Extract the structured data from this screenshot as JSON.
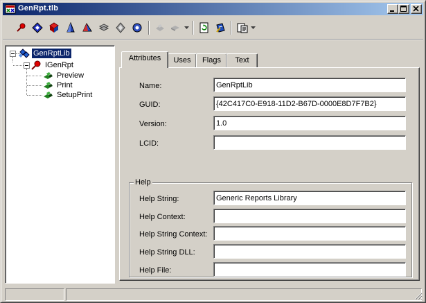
{
  "window": {
    "title": "GenRpt.tlb"
  },
  "toolbar": {
    "buttons": [
      {
        "name": "module-icon"
      },
      {
        "name": "dispinterface-icon"
      },
      {
        "name": "interface-icon"
      },
      {
        "name": "coclass-icon"
      },
      {
        "name": "enum-icon"
      },
      {
        "name": "record-icon"
      },
      {
        "name": "union-icon"
      },
      {
        "name": "alias-icon"
      },
      {
        "name": "method-icon"
      },
      {
        "name": "property-icon"
      },
      {
        "name": "refresh-icon"
      },
      {
        "name": "register-icon"
      },
      {
        "name": "export-icon"
      }
    ]
  },
  "tree": {
    "root": {
      "label": "GenRptLib"
    },
    "interface": {
      "label": "IGenRpt"
    },
    "methods": [
      "Preview",
      "Print",
      "SetupPrint"
    ]
  },
  "tabs": [
    "Attributes",
    "Uses",
    "Flags",
    "Text"
  ],
  "attributes": {
    "name_label": "Name:",
    "name_value": "GenRptLib",
    "guid_label": "GUID:",
    "guid_value": "{42C417C0-E918-11D2-B67D-0000E8D7F7B2}",
    "version_label": "Version:",
    "version_value": "1.0",
    "lcid_label": "LCID:",
    "lcid_value": ""
  },
  "help": {
    "group_label": "Help",
    "string_label": "Help String:",
    "string_value": "Generic Reports Library",
    "context_label": "Help Context:",
    "context_value": "",
    "string_context_label": "Help String Context:",
    "string_context_value": "",
    "string_dll_label": "Help String DLL:",
    "string_dll_value": "",
    "file_label": "Help File:",
    "file_value": ""
  },
  "colors": {
    "titlebar_start": "#0a246a",
    "titlebar_end": "#a6caf0",
    "face": "#d4d0c8",
    "selection": "#0a246a"
  }
}
